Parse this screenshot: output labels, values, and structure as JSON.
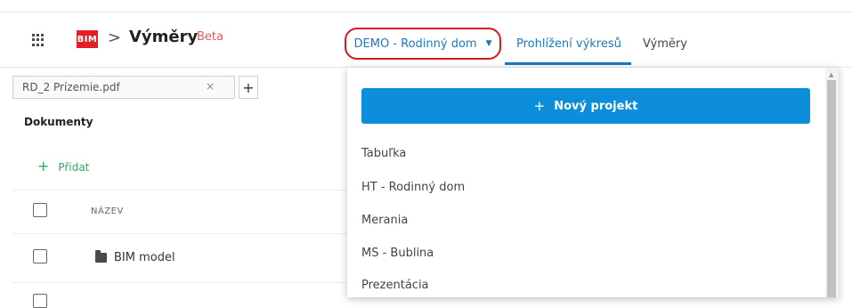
{
  "header": {
    "logo_text": "BIM",
    "separator": ">",
    "app_title": "Výměry",
    "beta_label": "Beta",
    "project_selected": "DEMO - Rodinný dom",
    "tabs": [
      {
        "label": "Prohlížení výkresů",
        "active": true
      },
      {
        "label": "Výměry",
        "active": false
      }
    ]
  },
  "documents_panel": {
    "open_tab": "RD_2 Prízemie.pdf",
    "close_symbol": "×",
    "add_tab_symbol": "+",
    "heading": "Dokumenty",
    "add_label": "Přidat",
    "add_symbol": "+",
    "column_name": "NÁZEV",
    "rows": [
      {
        "name": "BIM model",
        "type": "folder"
      }
    ]
  },
  "project_dropdown": {
    "new_project_label": "Nový projekt",
    "new_project_symbol": "+",
    "items": [
      "Tabuľka",
      "HT - Rodinný dom",
      "Merania",
      "MS - Bublina",
      "Prezentácia"
    ]
  },
  "colors": {
    "accent_blue": "#1a78c2",
    "button_blue": "#0d8edb",
    "highlight_red": "#d9181f",
    "add_green": "#2eaa5f",
    "logo_red": "#e21f26"
  }
}
